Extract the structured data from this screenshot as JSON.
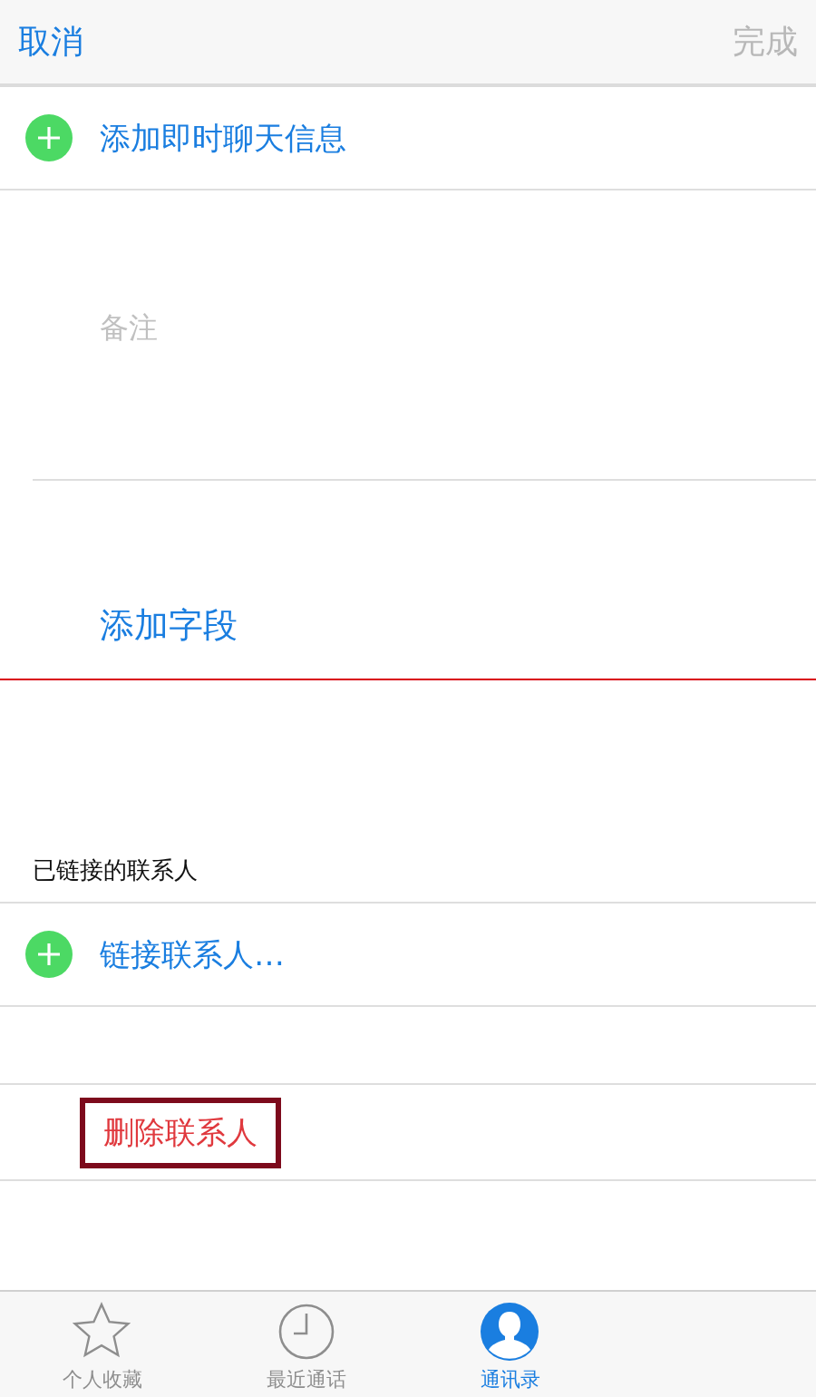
{
  "nav_bar": {
    "cancel": "取消",
    "done": {
      "label": "完成",
      "disabled": true
    }
  },
  "add_rows": [
    {
      "label": "添加即时聊天信息"
    }
  ],
  "notes": {
    "placeholder": "备注"
  },
  "add_field": {
    "label": "添加字段",
    "marked": true
  },
  "linked_section": {
    "header": "已链接的联系人",
    "rows": [
      {
        "label": "链接联系人…"
      }
    ]
  },
  "delete": {
    "label": "删除联系人",
    "highlighted": true
  },
  "tab_bar": {
    "tabs": [
      {
        "kind": "star",
        "label": "个人收藏",
        "selected": false
      },
      {
        "kind": "clock",
        "label": "最近通话",
        "selected": false
      },
      {
        "kind": "person",
        "label": "通讯录",
        "selected": true
      }
    ]
  }
}
